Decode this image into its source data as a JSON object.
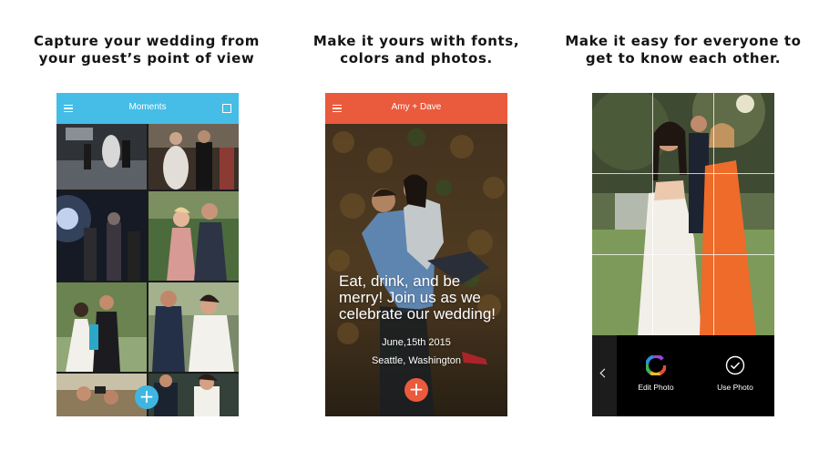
{
  "colors": {
    "moments_bar": "#45bde6",
    "amy_bar": "#ea5a3c",
    "fab_blue": "#3fb6e2",
    "fab_orange": "#ea5a3c",
    "edit_bg": "#000000"
  },
  "panels": [
    {
      "caption_lines": [
        "Capture  your wedding from",
        "your guest’s point of view"
      ],
      "app_title": "Moments",
      "left_icon": "hamburger-menu-icon",
      "right_icon": "square-select-icon",
      "fab_icon": "plus-icon",
      "fab_label": "+"
    },
    {
      "caption_lines": [
        "Make it yours with fonts,",
        "colors and photos."
      ],
      "app_title": "Amy + Dave",
      "left_icon": "hamburger-menu-icon",
      "invite_lines": [
        "Eat, drink, and be",
        "merry! Join us as we",
        "celebrate our wedding!"
      ],
      "date": "June,15th 2015",
      "location": "Seattle, Washington",
      "fab_icon": "plus-icon",
      "fab_label": "+"
    },
    {
      "caption_lines": [
        "Make it easy for everyone to",
        "get to know each other."
      ],
      "back_icon": "chevron-left-icon",
      "actions": [
        {
          "label": "Edit Photo",
          "icon": "color-wheel-icon"
        },
        {
          "label": "Use Photo",
          "icon": "checkmark-circle-icon"
        }
      ]
    }
  ]
}
